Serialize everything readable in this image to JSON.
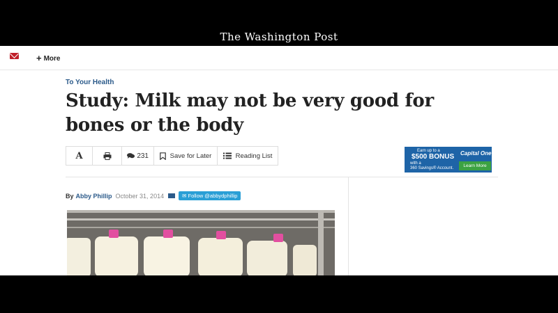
{
  "masthead": {
    "title": "The Washington Post"
  },
  "nav": {
    "more_label": "More",
    "mail_icon": "mail-icon",
    "plus_icon": "plus-icon"
  },
  "article": {
    "kicker": "To Your Health",
    "headline": "Study: Milk may not be very good for bones or the body",
    "byline_prefix": "By",
    "author": "Abby Phillip",
    "date": "October 31, 2014",
    "follow_label": "Follow @abbydphillip"
  },
  "toolbar": {
    "font_label": "A",
    "comment_count": "231",
    "save_label": "Save for Later",
    "reading_list_label": "Reading List",
    "icons": [
      "font-size-icon",
      "print-icon",
      "comments-icon",
      "bookmark-icon",
      "list-icon"
    ]
  },
  "ad": {
    "line1": "Earn up to a",
    "line2": "$500 BONUS",
    "line3": "with a",
    "line4": "360 Savings® Account.",
    "brand": "Capital One",
    "cta": "Learn More",
    "color": "#1e64a7",
    "cta_color": "#3ca242"
  },
  "colors": {
    "accent": "#c0202a",
    "link": "#2b5a8a",
    "twitter": "#2a9fd6"
  }
}
